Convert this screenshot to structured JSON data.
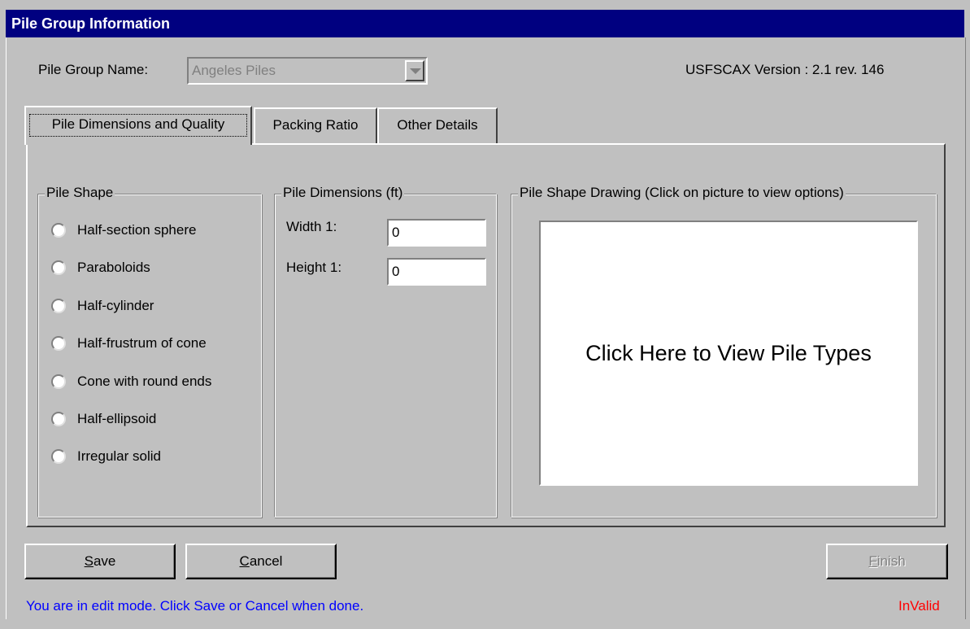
{
  "window": {
    "title": "Pile Group Information"
  },
  "header": {
    "pile_group_label": "Pile Group Name:",
    "pile_group_value": "Angeles Piles",
    "version_text": "USFSCAX Version : 2.1 rev. 146"
  },
  "tabs": [
    {
      "label": "Pile Dimensions and Quality",
      "active": true
    },
    {
      "label": "Packing Ratio",
      "active": false
    },
    {
      "label": "Other Details",
      "active": false
    }
  ],
  "pile_shape": {
    "title": "Pile Shape",
    "options": [
      "Half-section sphere",
      "Paraboloids",
      "Half-cylinder",
      "Half-frustrum of cone",
      "Cone with round ends",
      "Half-ellipsoid",
      "Irregular solid"
    ]
  },
  "pile_dimensions": {
    "title": "Pile Dimensions (ft)",
    "width_label": "Width 1:",
    "width_value": "0",
    "height_label": "Height 1:",
    "height_value": "0"
  },
  "drawing": {
    "title": "Pile Shape Drawing (Click on picture to view options)",
    "prompt": "Click Here to View Pile Types"
  },
  "buttons": {
    "save": "Save",
    "cancel": "Cancel",
    "finish": "Finish"
  },
  "status": {
    "message": "You are in edit mode.  Click Save or Cancel when done.",
    "validity": "InValid"
  },
  "colors": {
    "titlebar": "#000080",
    "face": "#c0c0c0",
    "status_text": "#0000ff",
    "invalid_text": "#ff0000"
  }
}
